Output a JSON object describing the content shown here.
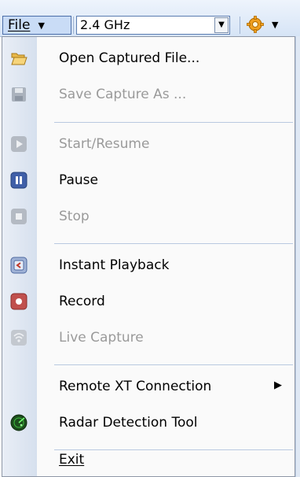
{
  "toolbar": {
    "file_label": "File",
    "frequency_value": "2.4 GHz"
  },
  "menu": {
    "open_captured_file": "Open Captured File...",
    "save_capture_as": "Save Capture As ...",
    "start_resume": "Start/Resume",
    "pause": "Pause",
    "stop": "Stop",
    "instant_playback": "Instant Playback",
    "record": "Record",
    "live_capture": "Live Capture",
    "remote_xt_connection": "Remote XT Connection",
    "radar_detection_tool": "Radar Detection Tool",
    "exit": "Exit"
  },
  "colors": {
    "disabled_text": "#9a9a9a",
    "accent_blue": "#3f5fa8",
    "record_red": "#c0504d"
  }
}
